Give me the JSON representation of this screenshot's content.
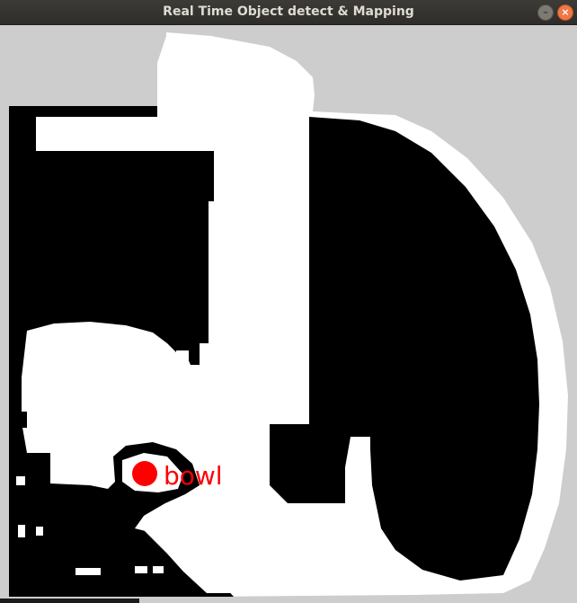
{
  "window": {
    "title": "Real Time Object detect & Mapping",
    "buttons": {
      "minimize": "–",
      "close": "×"
    }
  },
  "map": {
    "colors": {
      "background": "#cdcdcd",
      "occupied": "#000000",
      "free": "#ffffff"
    },
    "detections": [
      {
        "label": "bowl",
        "color": "#ff0000"
      }
    ]
  }
}
